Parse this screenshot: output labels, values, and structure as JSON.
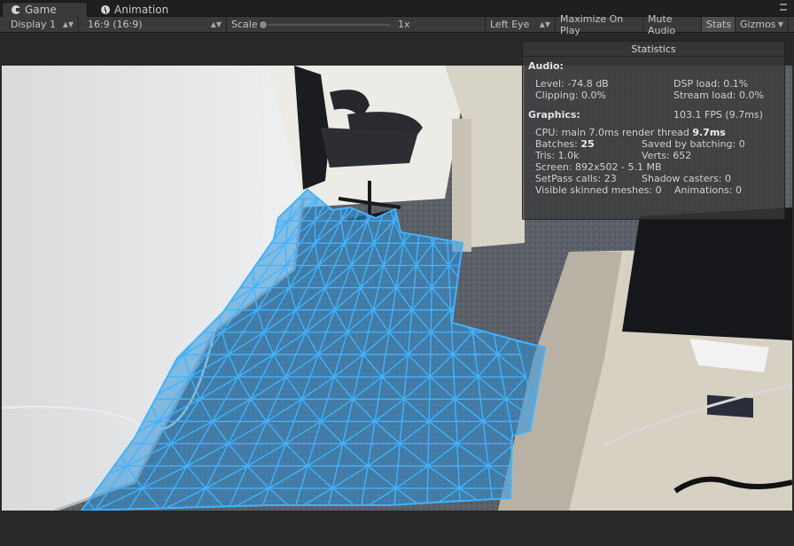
{
  "tabs": [
    {
      "label": "Game",
      "icon": "pacman-icon",
      "active": true
    },
    {
      "label": "Animation",
      "icon": "clock-icon",
      "active": false
    }
  ],
  "toolbar": {
    "display": "Display 1",
    "aspect": "16:9 (16:9)",
    "scale_label": "Scale",
    "scale_value": "1x",
    "eye": "Left Eye",
    "maximize": "Maximize On Play",
    "mute": "Mute Audio",
    "stats": "Stats",
    "gizmos": "Gizmos"
  },
  "stats": {
    "title": "Statistics",
    "audio_header": "Audio:",
    "level": "Level: -74.8 dB",
    "clipping": "Clipping: 0.0%",
    "dsp": "DSP load: 0.1%",
    "stream": "Stream load: 0.0%",
    "graphics_header": "Graphics:",
    "fps": "103.1 FPS (9.7ms)",
    "cpu_prefix": "CPU: main 7.0ms  render thread ",
    "cpu_render": "9.7ms",
    "batches_label": "Batches: ",
    "batches_value": "25",
    "saved_batching": "Saved by batching: 0",
    "tris": "Tris: 1.0k",
    "verts": "Verts: 652",
    "screen": "Screen: 892x502 - 5.1 MB",
    "setpass": "SetPass calls: 23",
    "shadow": "Shadow casters: 0",
    "skinned": "Visible skinned meshes: 0",
    "animations": "Animations: 0"
  },
  "colors": {
    "mesh_fill": "#2f93d8",
    "mesh_line": "#3fb4ff",
    "carpet": "#5b5f66",
    "wall": "#e4e6e8",
    "desk": "#d9d4c8"
  }
}
